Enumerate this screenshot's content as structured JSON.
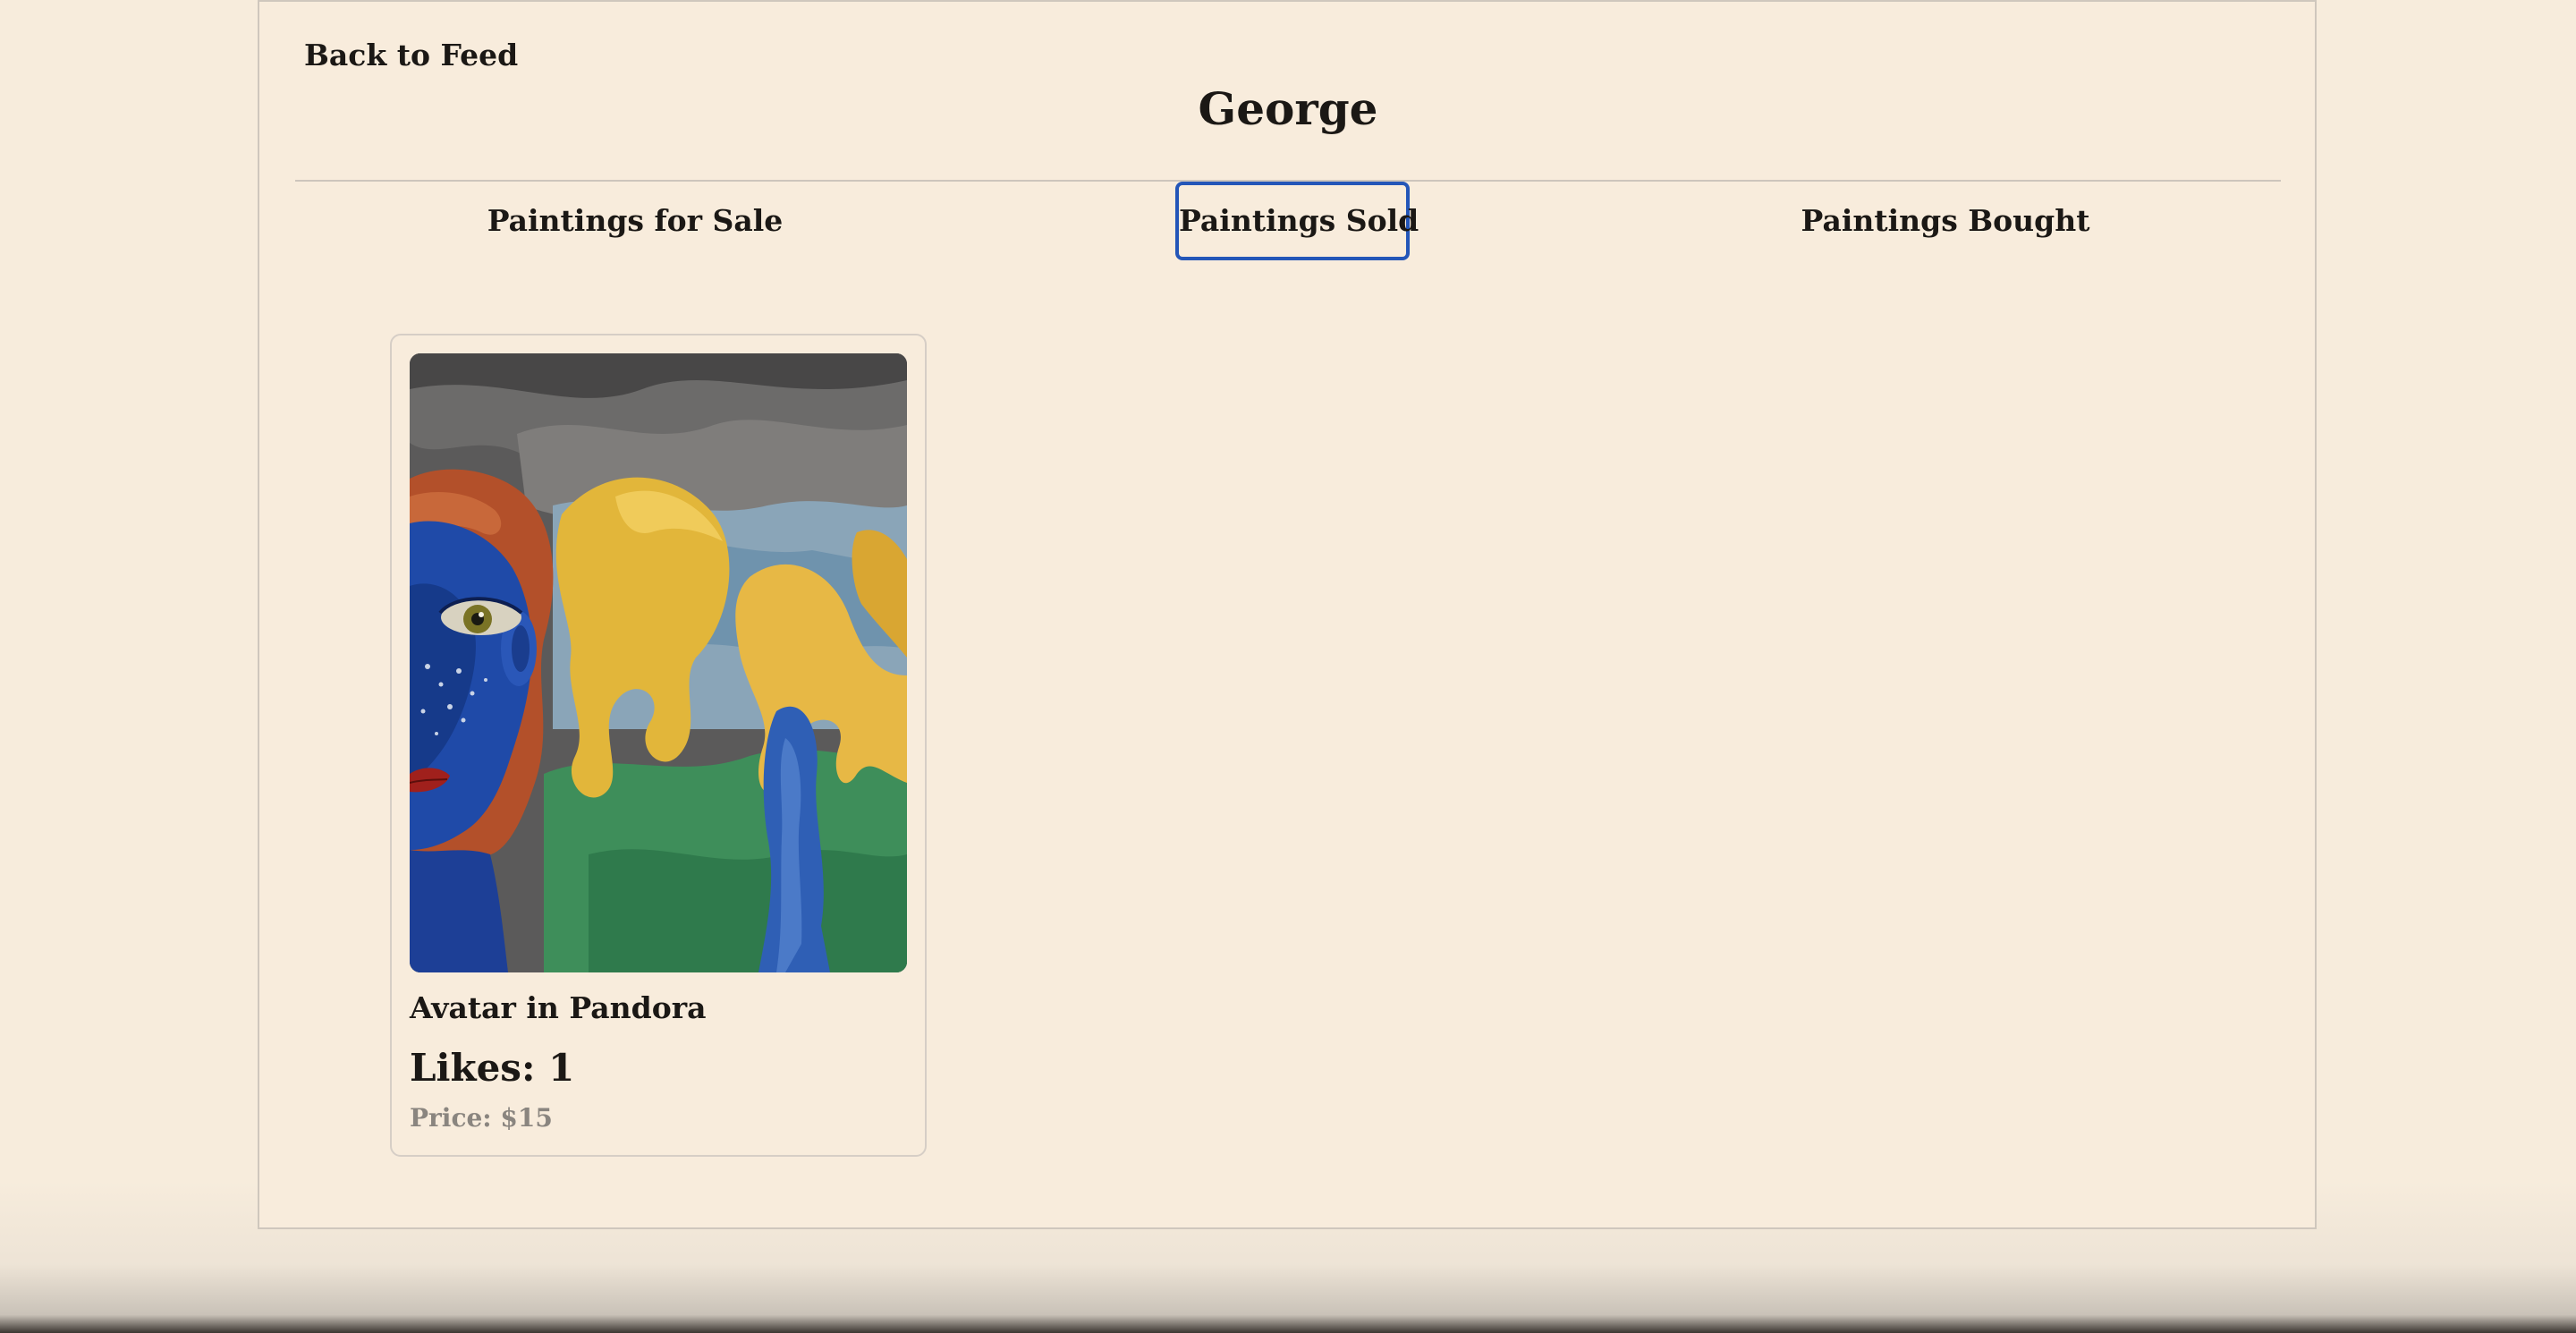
{
  "nav": {
    "back_label": "Back to Feed"
  },
  "profile": {
    "name": "George"
  },
  "tabs": [
    {
      "label": "Paintings for Sale",
      "active": false
    },
    {
      "label": "Paintings Sold",
      "active": true
    },
    {
      "label": "Paintings Bought",
      "active": false
    }
  ],
  "paintings": [
    {
      "title": "Avatar in Pandora",
      "likes": "Likes: 1",
      "price": "Price: $15"
    }
  ],
  "colors": {
    "background": "#f7ecdc",
    "active_tab_border": "#2456b8",
    "price_text": "#8a857f"
  }
}
